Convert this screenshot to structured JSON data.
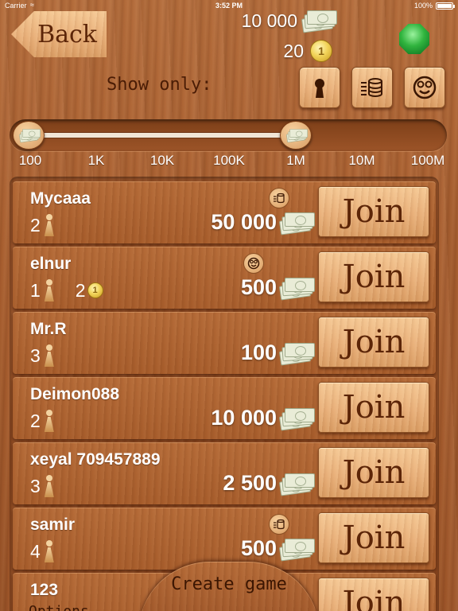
{
  "status_bar": {
    "carrier": "Carrier",
    "time": "3:52 PM",
    "battery": "100%",
    "battery_level": 1.0
  },
  "header": {
    "back_label": "Back",
    "money_amount": "10 000",
    "coins_amount": "20",
    "coin_symbol": "1",
    "gem_icon": "emerald-gem-icon"
  },
  "filters": {
    "label": "Show only:",
    "buttons": [
      {
        "name": "keyhole",
        "icon": "keyhole-icon"
      },
      {
        "name": "coin-stack",
        "icon": "coin-stack-icon"
      },
      {
        "name": "smiley",
        "icon": "smiley-icon"
      }
    ]
  },
  "stake_slider": {
    "ticks": [
      "100",
      "1K",
      "10K",
      "100K",
      "1M",
      "10M",
      "100M"
    ],
    "min_value": "100",
    "max_value": "1M"
  },
  "games": [
    {
      "name": "Mycaaa",
      "players": "2",
      "coins": "",
      "bet": "50 000",
      "type_icon": "coin-stack-icon",
      "join": "Join"
    },
    {
      "name": "elnur",
      "players": "1",
      "coins": "2",
      "bet": "500",
      "type_icon": "smiley-icon",
      "join": "Join"
    },
    {
      "name": "Mr.R",
      "players": "3",
      "coins": "",
      "bet": "100",
      "type_icon": "",
      "join": "Join"
    },
    {
      "name": "Deimon088",
      "players": "2",
      "coins": "",
      "bet": "10 000",
      "type_icon": "",
      "join": "Join"
    },
    {
      "name": "xeyal 709457889",
      "players": "3",
      "coins": "",
      "bet": "2 500",
      "type_icon": "",
      "join": "Join"
    },
    {
      "name": "samir",
      "players": "4",
      "coins": "",
      "bet": "500",
      "type_icon": "coin-stack-icon",
      "join": "Join"
    },
    {
      "name": "123",
      "players": "",
      "coins": "",
      "bet": "",
      "type_icon": "",
      "join": "Join"
    }
  ],
  "footer": {
    "create_game": "Create game",
    "options": "Options"
  },
  "colors": {
    "wood_dark": "#9c5428",
    "wood_button": "#e9b07a",
    "text_brown": "#5c2508"
  }
}
